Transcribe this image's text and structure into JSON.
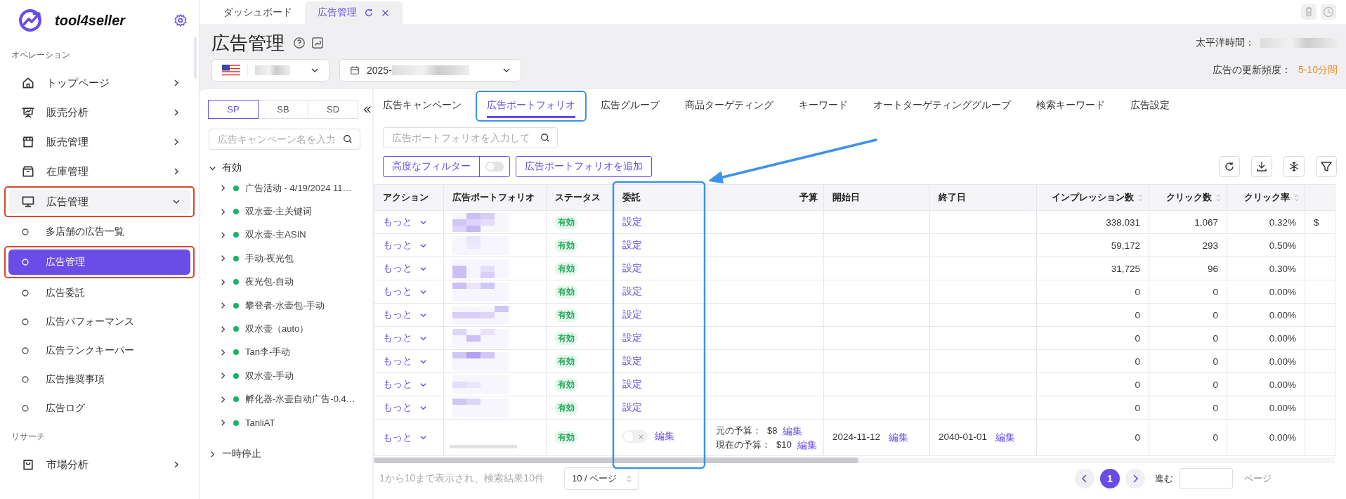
{
  "app": {
    "brand": "tool4seller"
  },
  "sidebar": {
    "sections": [
      {
        "title": "オペレーション",
        "items": [
          {
            "label": "トップページ",
            "expanded": false
          },
          {
            "label": "販売分析",
            "expanded": false
          },
          {
            "label": "販売管理",
            "expanded": false
          },
          {
            "label": "在庫管理",
            "expanded": false
          },
          {
            "label": "広告管理",
            "expanded": true,
            "children": [
              {
                "label": "多店舗の広告一覧",
                "selected": false
              },
              {
                "label": "広告管理",
                "selected": true
              },
              {
                "label": "広告委託",
                "selected": false
              },
              {
                "label": "広告パフォーマンス",
                "selected": false
              },
              {
                "label": "広告ランクキーパー",
                "selected": false
              },
              {
                "label": "広告推奨事項",
                "selected": false
              },
              {
                "label": "広告ログ",
                "selected": false
              }
            ]
          }
        ]
      },
      {
        "title": "リサーチ",
        "items": [
          {
            "label": "市場分析",
            "expanded": false
          }
        ]
      }
    ]
  },
  "page_tabs": [
    {
      "label": "ダッシュボード",
      "selected": false
    },
    {
      "label": "広告管理",
      "selected": true
    }
  ],
  "page": {
    "title": "広告管理",
    "timezone_label": "太平洋時間：",
    "date_prefix": "2025-",
    "update_label": "広告の更新頻度：",
    "update_value": "5-10分間"
  },
  "campaign_panel": {
    "ad_types": [
      {
        "label": "SP",
        "selected": true
      },
      {
        "label": "SB",
        "selected": false
      },
      {
        "label": "SD",
        "selected": false
      }
    ],
    "search_placeholder": "広告キャンペーン名を入力",
    "groups": [
      {
        "label": "有効",
        "expanded": true,
        "children": [
          {
            "label": "广告活动 - 4/19/2024 11…",
            "expanded": false
          },
          {
            "label": "双水壶-主关键词",
            "expanded": false
          },
          {
            "label": "双水壶-主ASIN",
            "expanded": false
          },
          {
            "label": "手动-夜光包",
            "expanded": false
          },
          {
            "label": "夜光包-自动",
            "expanded": false
          },
          {
            "label": "攀登者-水壶包-手动",
            "expanded": false
          },
          {
            "label": "双水壶（auto）",
            "expanded": false
          },
          {
            "label": "Tan李-手动",
            "expanded": false
          },
          {
            "label": "双水壶-手动",
            "expanded": false
          },
          {
            "label": "孵化器-水壶自动广告-0.4…",
            "expanded": false
          },
          {
            "label": "TanliAT",
            "expanded": false
          }
        ]
      },
      {
        "label": "一時停止",
        "expanded": false
      }
    ]
  },
  "portfolio_view": {
    "tabs": [
      {
        "label": "広告キャンペーン",
        "selected": false
      },
      {
        "label": "広告ポートフォリオ",
        "selected": true
      },
      {
        "label": "広告グループ",
        "selected": false
      },
      {
        "label": "商品ターゲティング",
        "selected": false
      },
      {
        "label": "キーワード",
        "selected": false
      },
      {
        "label": "オートターゲティンググループ",
        "selected": false
      },
      {
        "label": "検索キーワード",
        "selected": false
      },
      {
        "label": "広告設定",
        "selected": false
      }
    ],
    "search_placeholder": "広告ポートフォリオを入力して",
    "filter_button": "高度なフィルター",
    "filter_toggle_on": false,
    "add_button": "広告ポートフォリオを追加",
    "table": {
      "columns": [
        {
          "label": "アクション",
          "sortable": false
        },
        {
          "label": "広告ポートフォリオ",
          "sortable": false
        },
        {
          "label": "ステータス",
          "sortable": false
        },
        {
          "label": "委託",
          "sortable": false
        },
        {
          "label": "予算",
          "sortable": false
        },
        {
          "label": "開始日",
          "sortable": false
        },
        {
          "label": "終了日",
          "sortable": false
        },
        {
          "label": "インプレッション数",
          "sortable": true
        },
        {
          "label": "クリック数",
          "sortable": true
        },
        {
          "label": "クリック率",
          "sortable": true
        }
      ],
      "rows": [
        {
          "action": "もっと",
          "status": "有効",
          "delegation": {
            "kind": "link",
            "label": "設定"
          },
          "impressions": "338,031",
          "clicks": "1,067",
          "ctr": "0.32%",
          "column_11": "$"
        },
        {
          "action": "もっと",
          "status": "有効",
          "delegation": {
            "kind": "link",
            "label": "設定"
          },
          "impressions": "59,172",
          "clicks": "293",
          "ctr": "0.50%"
        },
        {
          "action": "もっと",
          "status": "有効",
          "delegation": {
            "kind": "link",
            "label": "設定"
          },
          "impressions": "31,725",
          "clicks": "96",
          "ctr": "0.30%"
        },
        {
          "action": "もっと",
          "status": "有効",
          "delegation": {
            "kind": "link",
            "label": "設定"
          },
          "impressions": "0",
          "clicks": "0",
          "ctr": "0.00%"
        },
        {
          "action": "もっと",
          "status": "有効",
          "delegation": {
            "kind": "link",
            "label": "設定"
          },
          "impressions": "0",
          "clicks": "0",
          "ctr": "0.00%"
        },
        {
          "action": "もっと",
          "status": "有効",
          "delegation": {
            "kind": "link",
            "label": "設定"
          },
          "impressions": "0",
          "clicks": "0",
          "ctr": "0.00%"
        },
        {
          "action": "もっと",
          "status": "有効",
          "delegation": {
            "kind": "link",
            "label": "設定"
          },
          "impressions": "0",
          "clicks": "0",
          "ctr": "0.00%"
        },
        {
          "action": "もっと",
          "status": "有効",
          "delegation": {
            "kind": "link",
            "label": "設定"
          },
          "impressions": "0",
          "clicks": "0",
          "ctr": "0.00%"
        },
        {
          "action": "もっと",
          "status": "有効",
          "delegation": {
            "kind": "link",
            "label": "設定"
          },
          "impressions": "0",
          "clicks": "0",
          "ctr": "0.00%"
        },
        {
          "action": "もっと",
          "status": "有効",
          "delegation": {
            "kind": "toggle",
            "on": false,
            "edit": "編集"
          },
          "budget": [
            {
              "label": "元の予算：",
              "value": "$8",
              "edit": "編集"
            },
            {
              "label": "現在の予算：",
              "value": "$10",
              "edit": "編集"
            }
          ],
          "start_date": {
            "value": "2024-11-12",
            "edit": "編集"
          },
          "end_date": {
            "value": "2040-01-01",
            "edit": "編集"
          },
          "impressions": "0",
          "clicks": "0",
          "ctr": "0.00%"
        }
      ]
    },
    "pagination": {
      "summary": "1から10まで表示され、検索結果10件",
      "page_size": "10 / ページ",
      "pages": [
        {
          "label": "1",
          "selected": true
        }
      ],
      "goto_label": "進む",
      "goto_suffix": "ページ"
    }
  }
}
